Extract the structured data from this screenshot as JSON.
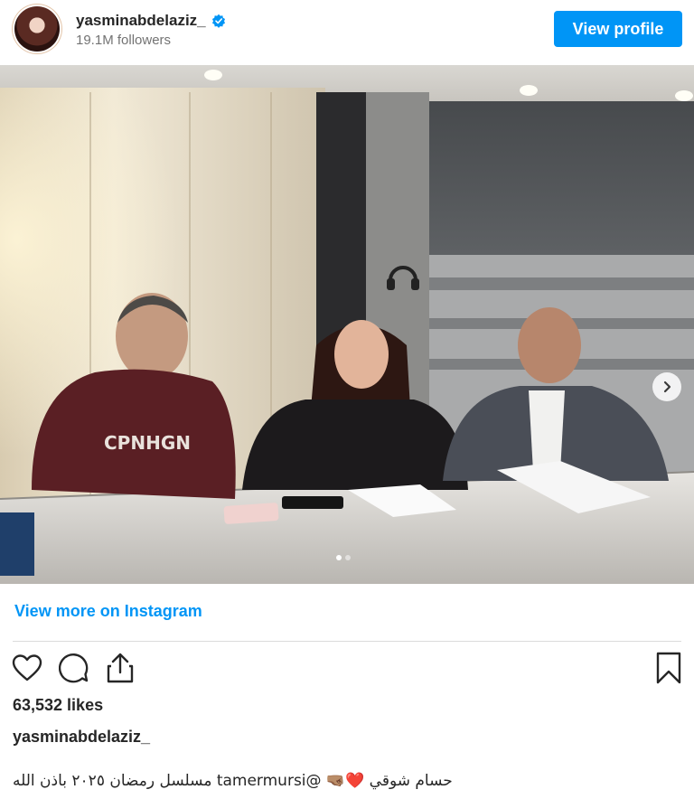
{
  "profile": {
    "username": "yasminabdelaziz_",
    "followers": "19.1M followers",
    "view_profile_label": "View profile",
    "verified_icon": "verified-badge-icon"
  },
  "media": {
    "carousel_next_icon": "chevron-right-icon",
    "slide_index": 1,
    "slide_count": 2
  },
  "links": {
    "view_more": "View more on Instagram"
  },
  "actions": {
    "icons": [
      "heart-icon",
      "comment-icon",
      "share-icon",
      "bookmark-icon"
    ]
  },
  "post": {
    "likes": "63,532 likes",
    "caption_username": "yasminabdelaziz_",
    "caption": "حسام شوقي ❤️🤜🏽 @tamermursi مسلسل رمضان ٢٠٢٥ باذن الله"
  },
  "colors": {
    "accent": "#0095f6",
    "text": "#262626",
    "muted": "#737373",
    "divider": "#dbdbdb"
  }
}
